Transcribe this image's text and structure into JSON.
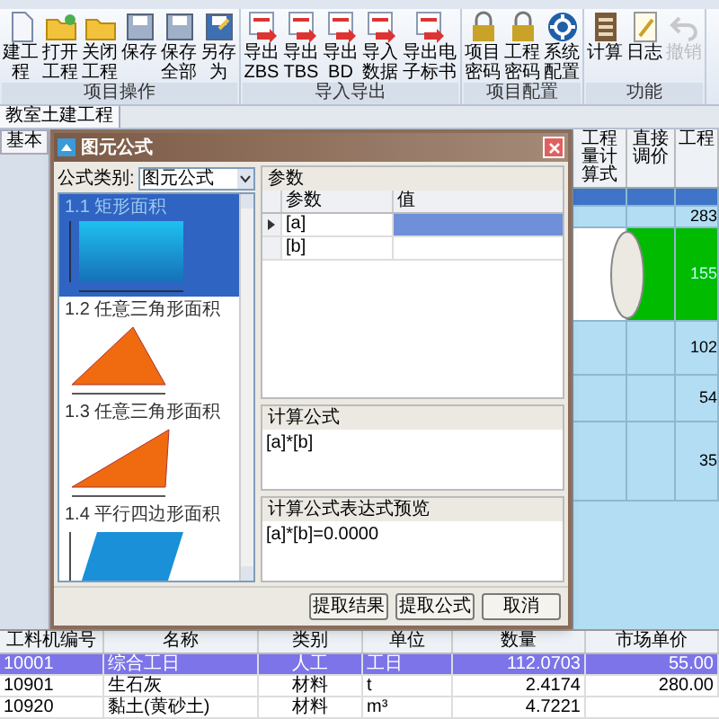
{
  "ribbon": {
    "groups": [
      {
        "label": "项目操作",
        "buttons": [
          {
            "label": "建工程",
            "disabled": false
          },
          {
            "label": "打开工程",
            "disabled": false
          },
          {
            "label": "关闭工程",
            "disabled": false
          },
          {
            "label": "保存",
            "disabled": false
          },
          {
            "label": "保存全部",
            "disabled": false
          },
          {
            "label": "另存为",
            "disabled": false
          }
        ]
      },
      {
        "label": "导入导出",
        "buttons": [
          {
            "label": "导出ZBS",
            "disabled": false
          },
          {
            "label": "导出TBS",
            "disabled": false
          },
          {
            "label": "导出BD",
            "disabled": false
          },
          {
            "label": "导入数据",
            "disabled": false
          },
          {
            "label": "导出电子标书",
            "disabled": false
          }
        ]
      },
      {
        "label": "项目配置",
        "buttons": [
          {
            "label": "项目密码",
            "disabled": false
          },
          {
            "label": "工程密码",
            "disabled": false
          },
          {
            "label": "系统配置",
            "disabled": false
          }
        ]
      },
      {
        "label": "功能",
        "buttons": [
          {
            "label": "计算",
            "disabled": false
          },
          {
            "label": "日志",
            "disabled": false
          },
          {
            "label": "撤销",
            "disabled": true
          }
        ]
      }
    ]
  },
  "project_tab": "教室土建工程",
  "side_tab": "基本",
  "grid": {
    "columns": [
      "工程量计算式",
      "直接调价",
      "工程"
    ],
    "rows": [
      {
        "selected": true,
        "kind": "plain"
      },
      {
        "column_3": "283",
        "selected": false,
        "kind": "plain"
      },
      {
        "column_3": "155",
        "selected": false,
        "kind": "green"
      },
      {
        "column_3": "102",
        "selected": false,
        "kind": "plain"
      },
      {
        "column_3": "54",
        "selected": false,
        "kind": "plain"
      },
      {
        "column_3": "35",
        "selected": false,
        "kind": "plain"
      }
    ]
  },
  "dialog": {
    "title": "图元公式",
    "category_label": "公式类别:",
    "category_value": "图元公式",
    "shapes": [
      {
        "label": "1.1 矩形面积",
        "selected": true
      },
      {
        "label": "1.2 任意三角形面积",
        "selected": false
      },
      {
        "label": "1.3 任意三角形面积",
        "selected": false
      },
      {
        "label": "1.4 平行四边形面积",
        "selected": false
      }
    ],
    "params_title": "参数",
    "param_columns": [
      "参数",
      "值"
    ],
    "params": [
      {
        "name": "[a]",
        "selected": true
      },
      {
        "name": "[b]",
        "selected": false
      }
    ],
    "formula_title": "计算公式",
    "formula": "[a]*[b]",
    "preview_title": "计算公式表达式预览",
    "preview": "[a]*[b]=0.0000",
    "buttons": [
      "提取结果",
      "提取公式",
      "取消"
    ]
  },
  "materials": {
    "columns": [
      "工料机编号",
      "名称",
      "类别",
      "单位",
      "数量",
      "市场单价"
    ],
    "rows": [
      {
        "cells": [
          "10001",
          "综合工日",
          "人工",
          "工日",
          "112.0703",
          "55.00"
        ],
        "selected": true
      },
      {
        "cells": [
          "10901",
          "生石灰",
          "材料",
          "t",
          "2.4174",
          "280.00"
        ],
        "selected": false
      },
      {
        "cells": [
          "10920",
          "黏土(黄砂土)",
          "材料",
          "m³",
          "4.7221"
        ],
        "selected": false
      }
    ]
  }
}
